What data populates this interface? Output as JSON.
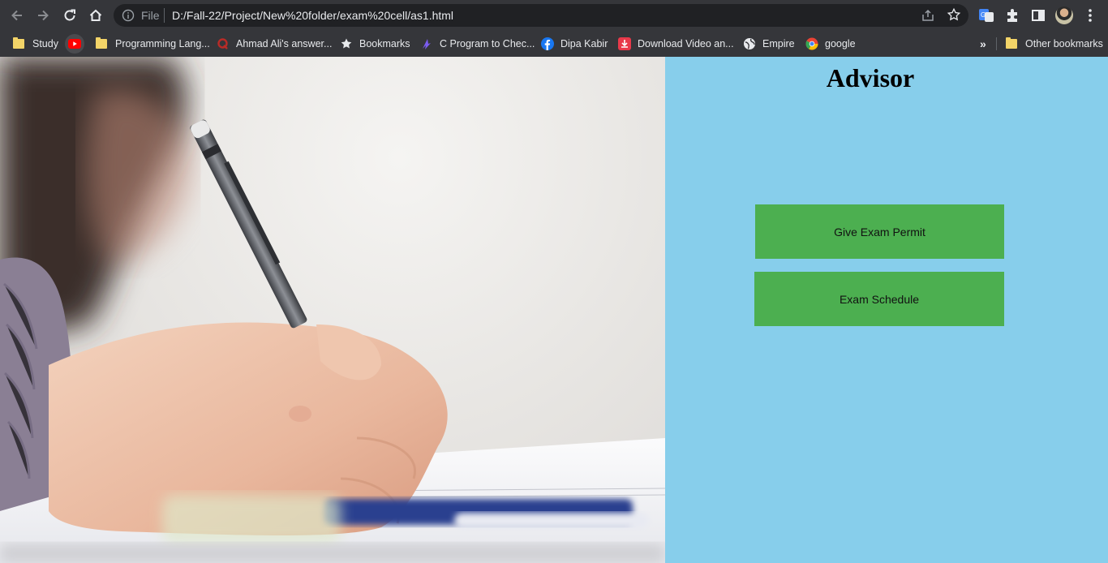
{
  "browser": {
    "scheme_label": "File",
    "url": "D:/Fall-22/Project/New%20folder/exam%20cell/as1.html",
    "bookmarks": [
      {
        "label": "Study",
        "icon": "folder-icon"
      },
      {
        "label": "",
        "icon": "youtube-icon"
      },
      {
        "label": "Programming Lang...",
        "icon": "folder-icon"
      },
      {
        "label": "Ahmad Ali's answer...",
        "icon": "quora-icon"
      },
      {
        "label": "Bookmarks",
        "icon": "star-icon"
      },
      {
        "label": "C Program to Chec...",
        "icon": "site-icon"
      },
      {
        "label": "Dipa Kabir",
        "icon": "facebook-icon"
      },
      {
        "label": "Download Video an...",
        "icon": "download-icon"
      },
      {
        "label": "Empire",
        "icon": "globe-icon"
      },
      {
        "label": "google",
        "icon": "chrome-icon"
      }
    ],
    "overflow_label": "»",
    "other_bookmarks_label": "Other bookmarks"
  },
  "page": {
    "title": "Advisor",
    "buttons": [
      {
        "label": "Give Exam Permit"
      },
      {
        "label": "Exam Schedule"
      }
    ],
    "colors": {
      "panel_bg": "#87ceeb",
      "button_bg": "#4caf50"
    }
  }
}
